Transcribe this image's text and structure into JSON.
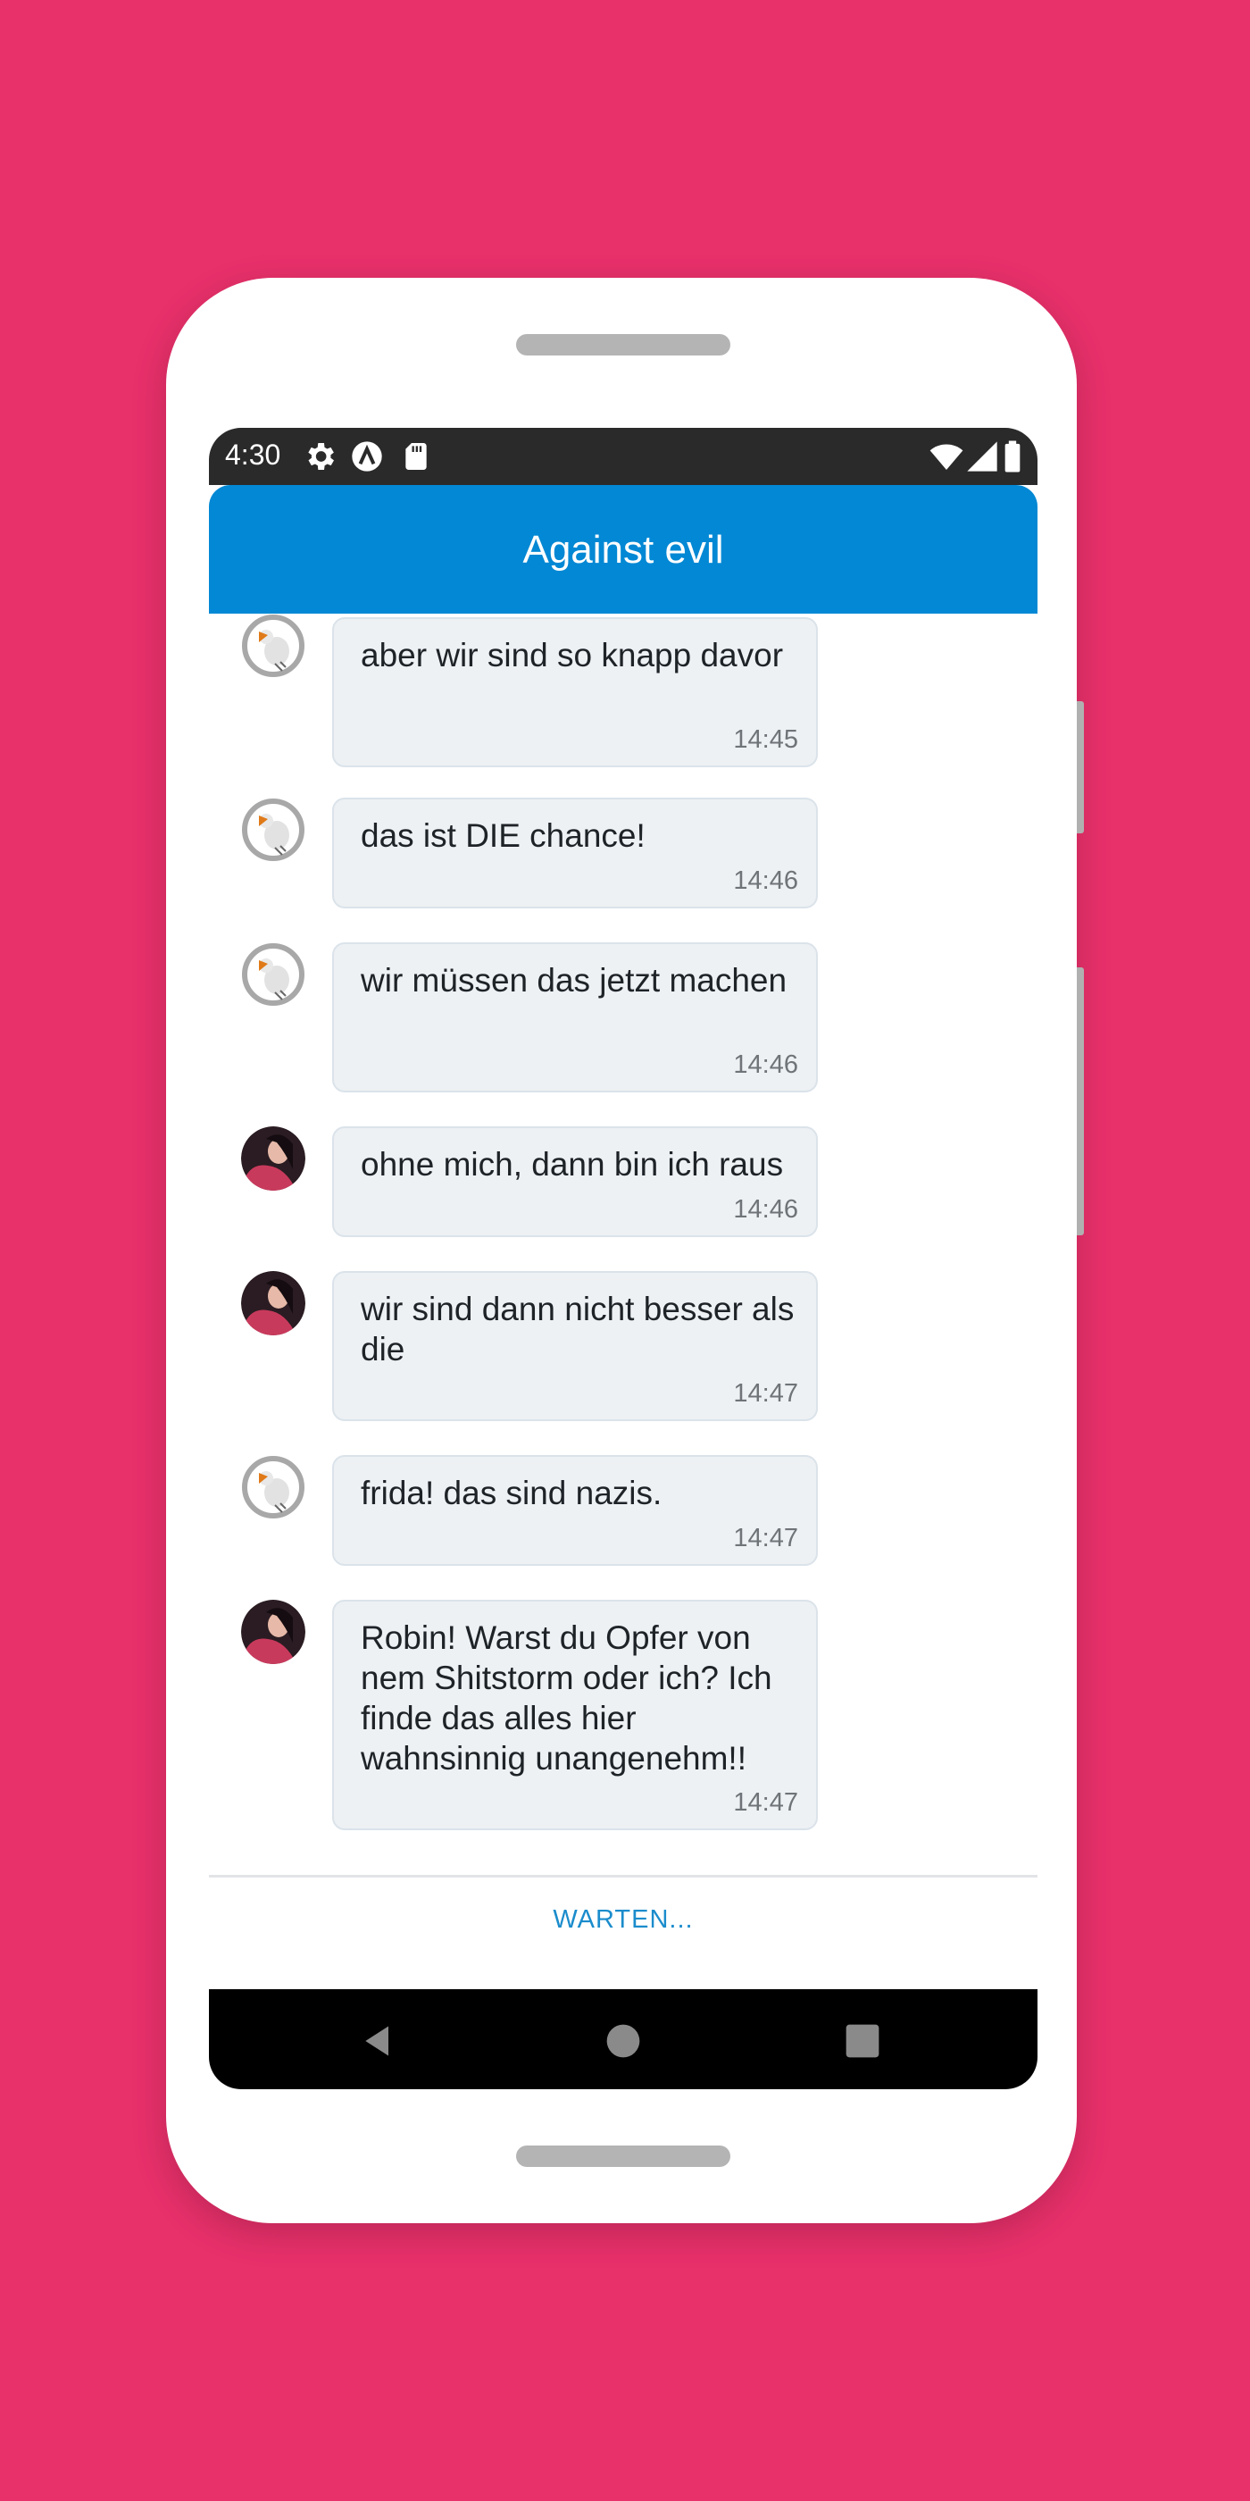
{
  "status_bar": {
    "time": "4:30",
    "left_icons": [
      "gear-icon",
      "a-circle-icon",
      "sd-card-icon"
    ],
    "right_icons": [
      "wifi-icon",
      "cell-signal-icon",
      "battery-icon"
    ]
  },
  "app_bar": {
    "title": "Against evil"
  },
  "messages": [
    {
      "sender": "bird",
      "avatar": "bird-avatar",
      "text": "aber wir sind so knapp davor",
      "time": "14:45"
    },
    {
      "sender": "bird",
      "avatar": "bird-avatar",
      "text": "das ist DIE chance!",
      "time": "14:46"
    },
    {
      "sender": "bird",
      "avatar": "bird-avatar",
      "text": "wir müssen das jetzt machen",
      "time": "14:46"
    },
    {
      "sender": "frida",
      "avatar": "girl-avatar",
      "text": "ohne mich, dann bin ich raus",
      "time": "14:46"
    },
    {
      "sender": "frida",
      "avatar": "girl-avatar",
      "text": "wir sind dann nicht besser als die",
      "time": "14:47"
    },
    {
      "sender": "bird",
      "avatar": "bird-avatar",
      "text": "frida! das sind nazis.",
      "time": "14:47"
    },
    {
      "sender": "frida",
      "avatar": "girl-avatar",
      "text": "Robin! Warst du Opfer von nem Shitstorm oder ich? Ich finde das alles hier wahnsinnig unangenehm!!",
      "time": "14:47"
    }
  ],
  "footer": {
    "action_label": "WARTEN..."
  },
  "nav_bar": {
    "icons": [
      "back-icon",
      "home-icon",
      "recents-icon"
    ]
  },
  "colors": {
    "background": "#e8306b",
    "app_bar": "#0288d4",
    "bubble": "#edf1f4",
    "action": "#1b8ccc"
  }
}
